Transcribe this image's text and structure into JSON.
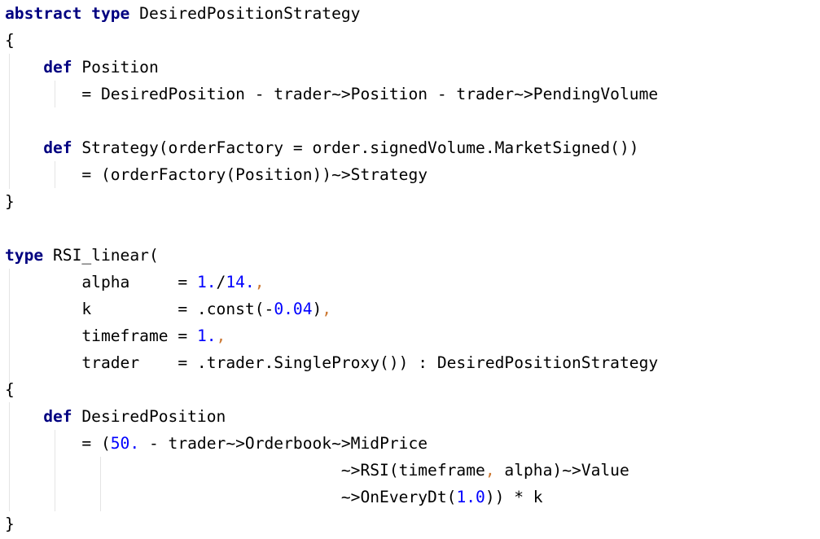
{
  "editor": {
    "lines": [
      [
        {
          "t": "abstract",
          "k": "kw"
        },
        {
          "t": " "
        },
        {
          "t": "type",
          "k": "kw"
        },
        {
          "t": " DesiredPositionStrategy"
        }
      ],
      [
        {
          "t": "{"
        }
      ],
      [
        {
          "t": "    "
        },
        {
          "t": "def",
          "k": "kw"
        },
        {
          "t": " Position"
        }
      ],
      [
        {
          "t": "        = DesiredPosition - trader~>Position - trader~>PendingVolume"
        }
      ],
      [],
      [
        {
          "t": "    "
        },
        {
          "t": "def",
          "k": "kw"
        },
        {
          "t": " Strategy(orderFactory = order.signedVolume.MarketSigned())"
        }
      ],
      [
        {
          "t": "        = (orderFactory(Position))~>Strategy"
        }
      ],
      [
        {
          "t": "}"
        }
      ],
      [],
      [
        {
          "t": "type",
          "k": "kw"
        },
        {
          "t": " RSI_linear("
        }
      ],
      [
        {
          "t": "        alpha     = "
        },
        {
          "t": "1.",
          "k": "num"
        },
        {
          "t": "/"
        },
        {
          "t": "14.",
          "k": "num"
        },
        {
          "t": ",",
          "k": "pn"
        }
      ],
      [
        {
          "t": "        k         = .const(-"
        },
        {
          "t": "0.04",
          "k": "num"
        },
        {
          "t": ")"
        },
        {
          "t": ",",
          "k": "pn"
        }
      ],
      [
        {
          "t": "        timeframe = "
        },
        {
          "t": "1.",
          "k": "num"
        },
        {
          "t": ",",
          "k": "pn"
        }
      ],
      [
        {
          "t": "        trader    = .trader.SingleProxy()) : DesiredPositionStrategy"
        }
      ],
      [
        {
          "t": "{"
        }
      ],
      [
        {
          "t": "    "
        },
        {
          "t": "def",
          "k": "kw"
        },
        {
          "t": " DesiredPosition"
        }
      ],
      [
        {
          "t": "        = ("
        },
        {
          "t": "50.",
          "k": "num"
        },
        {
          "t": " - trader~>Orderbook~>MidPrice"
        }
      ],
      [
        {
          "t": "                                   ~>RSI(timeframe"
        },
        {
          "t": ",",
          "k": "pn"
        },
        {
          "t": " alpha)~>Value"
        }
      ],
      [
        {
          "t": "                                   ~>OnEveryDt("
        },
        {
          "t": "1.0",
          "k": "num"
        },
        {
          "t": ")) * k"
        }
      ],
      [
        {
          "t": "}"
        }
      ]
    ]
  }
}
